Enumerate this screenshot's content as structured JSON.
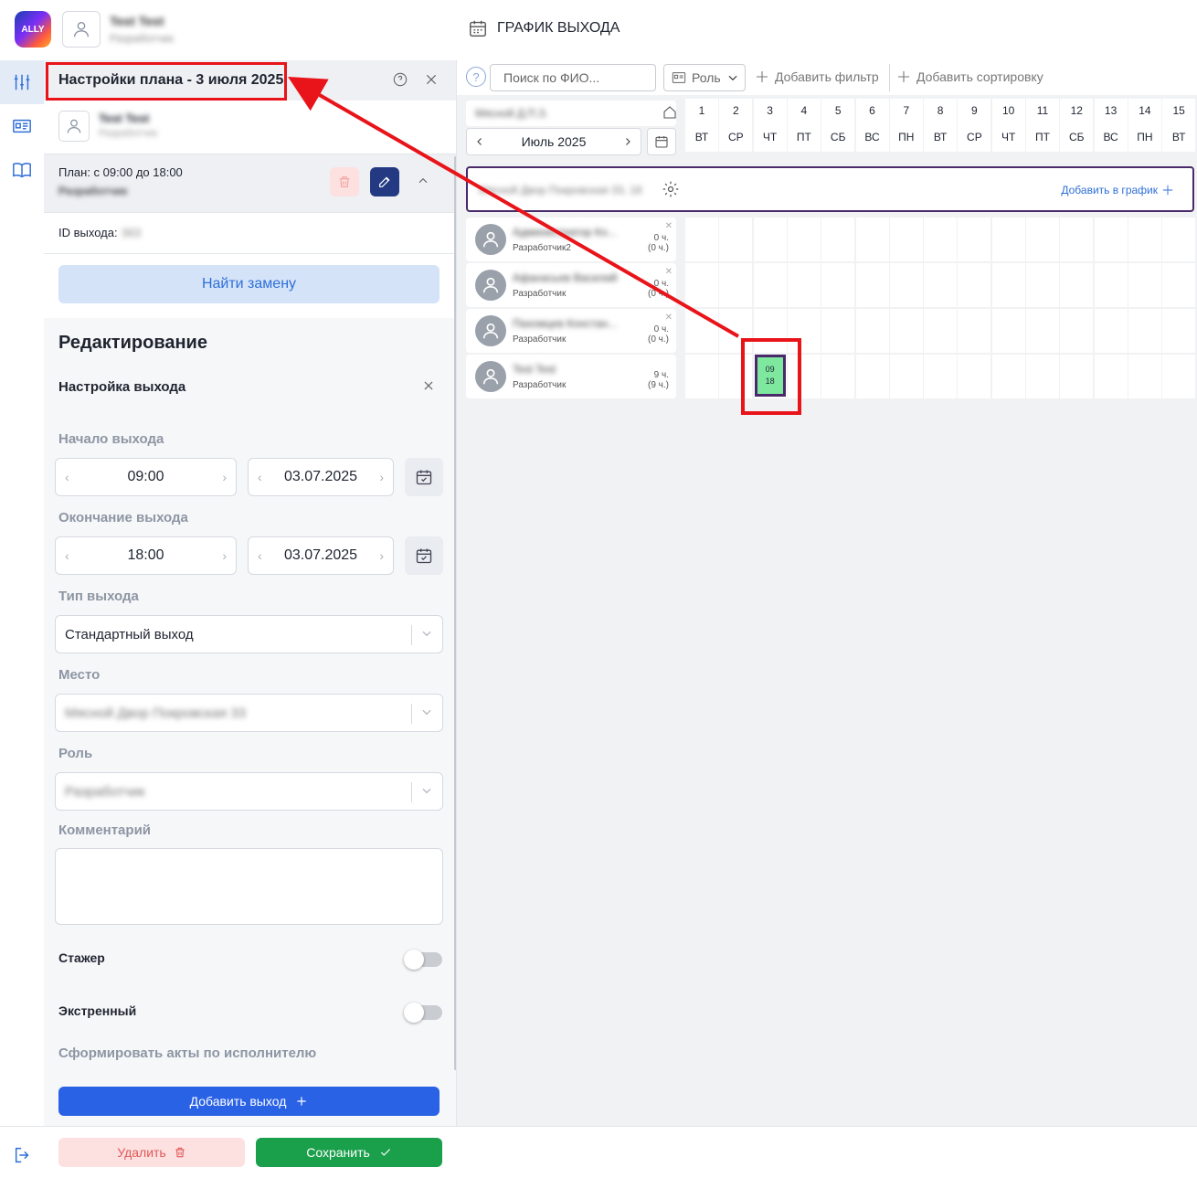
{
  "header": {
    "logo_text": "ALLY",
    "user_name": "Test Test",
    "user_role": "Разработчик",
    "page_title": "ГРАФИК ВЫХОДА"
  },
  "rail": {
    "items": [
      {
        "icon": "sliders-icon",
        "active": true
      },
      {
        "icon": "id-card-icon",
        "active": false
      },
      {
        "icon": "book-icon",
        "active": false
      }
    ],
    "logout_icon": "logout-icon"
  },
  "panel": {
    "title": "Настройки плана - 3 июля 2025",
    "person_name": "Test Test",
    "person_role": "Разработчик",
    "plan_text": "План: с 09:00 до 18:00",
    "plan_role": "Разработчик",
    "id_label": "ID выхода:",
    "id_value": "363",
    "find_replacement": "Найти замену",
    "edit_heading": "Редактирование",
    "setup_title": "Настройка выхода",
    "start_label": "Начало выхода",
    "start_time": "09:00",
    "start_date": "03.07.2025",
    "end_label": "Окончание выхода",
    "end_time": "18:00",
    "end_date": "03.07.2025",
    "type_label": "Тип выхода",
    "type_value": "Стандартный выход",
    "place_label": "Место",
    "place_value": "Мясной Двор Покровская 33",
    "role_label": "Роль",
    "role_value": "Разработчик",
    "comment_label": "Комментарий",
    "comment_value": "",
    "intern_label": "Стажер",
    "intern_on": false,
    "urgent_label": "Экстренный",
    "urgent_on": false,
    "acts_label": "Сформировать акты по исполнителю",
    "add_shift": "Добавить выход"
  },
  "footer": {
    "delete": "Удалить",
    "save": "Сохранить"
  },
  "toolbar": {
    "help": "?",
    "search_placeholder": "Поиск по ФИО...",
    "role": "Роль",
    "add_filter": "Добавить фильтр",
    "add_sort": "Добавить сортировку"
  },
  "schedule": {
    "location": "Мясной Д.П.З.",
    "month": "Июль 2025",
    "days": [
      {
        "num": "1",
        "dow": "ВТ"
      },
      {
        "num": "2",
        "dow": "СР"
      },
      {
        "num": "3",
        "dow": "ЧТ"
      },
      {
        "num": "4",
        "dow": "ПТ"
      },
      {
        "num": "5",
        "dow": "СБ"
      },
      {
        "num": "6",
        "dow": "ВС"
      },
      {
        "num": "7",
        "dow": "ПН"
      },
      {
        "num": "8",
        "dow": "ВТ"
      },
      {
        "num": "9",
        "dow": "СР"
      },
      {
        "num": "10",
        "dow": "ЧТ"
      },
      {
        "num": "11",
        "dow": "ПТ"
      },
      {
        "num": "12",
        "dow": "СБ"
      },
      {
        "num": "13",
        "dow": "ВС"
      },
      {
        "num": "14",
        "dow": "ПН"
      },
      {
        "num": "15",
        "dow": "ВТ"
      }
    ],
    "group_name": "Мясной Двор Покровская 33, 18",
    "add_to_schedule": "Добавить в график",
    "employees": [
      {
        "name": "Администратор Ко...",
        "role": "Разработчик2",
        "hours": "0 ч.",
        "hours_sub": "(0 ч.)",
        "removable": true
      },
      {
        "name": "Афанасьев Василий",
        "role": "Разработчик",
        "hours": "0 ч.",
        "hours_sub": "(0 ч.)",
        "removable": true
      },
      {
        "name": "Пахомцев Констан...",
        "role": "Разработчик",
        "hours": "0 ч.",
        "hours_sub": "(0 ч.)",
        "removable": true
      },
      {
        "name": "Test Test",
        "role": "Разработчик",
        "hours": "9 ч.",
        "hours_sub": "(9 ч.)",
        "removable": false
      }
    ],
    "shift": {
      "employee_index": 3,
      "day": 3,
      "start": "09",
      "end": "18",
      "color": "#7ee89f"
    }
  }
}
